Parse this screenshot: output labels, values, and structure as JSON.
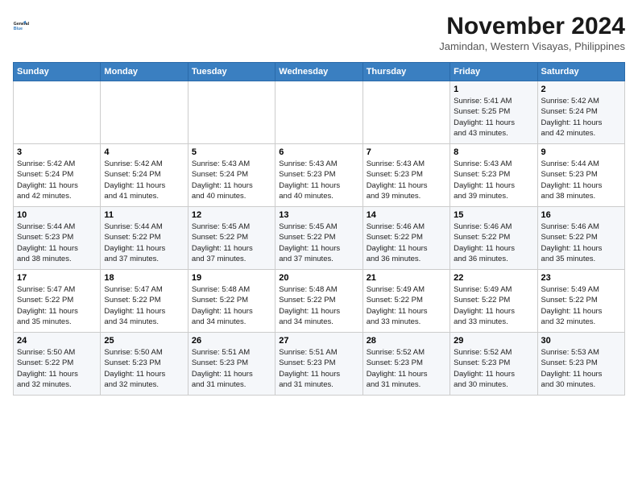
{
  "logo": {
    "line1": "General",
    "line2": "Blue"
  },
  "title": "November 2024",
  "subtitle": "Jamindan, Western Visayas, Philippines",
  "days_of_week": [
    "Sunday",
    "Monday",
    "Tuesday",
    "Wednesday",
    "Thursday",
    "Friday",
    "Saturday"
  ],
  "weeks": [
    [
      {
        "day": "",
        "info": ""
      },
      {
        "day": "",
        "info": ""
      },
      {
        "day": "",
        "info": ""
      },
      {
        "day": "",
        "info": ""
      },
      {
        "day": "",
        "info": ""
      },
      {
        "day": "1",
        "info": "Sunrise: 5:41 AM\nSunset: 5:25 PM\nDaylight: 11 hours\nand 43 minutes."
      },
      {
        "day": "2",
        "info": "Sunrise: 5:42 AM\nSunset: 5:24 PM\nDaylight: 11 hours\nand 42 minutes."
      }
    ],
    [
      {
        "day": "3",
        "info": "Sunrise: 5:42 AM\nSunset: 5:24 PM\nDaylight: 11 hours\nand 42 minutes."
      },
      {
        "day": "4",
        "info": "Sunrise: 5:42 AM\nSunset: 5:24 PM\nDaylight: 11 hours\nand 41 minutes."
      },
      {
        "day": "5",
        "info": "Sunrise: 5:43 AM\nSunset: 5:24 PM\nDaylight: 11 hours\nand 40 minutes."
      },
      {
        "day": "6",
        "info": "Sunrise: 5:43 AM\nSunset: 5:23 PM\nDaylight: 11 hours\nand 40 minutes."
      },
      {
        "day": "7",
        "info": "Sunrise: 5:43 AM\nSunset: 5:23 PM\nDaylight: 11 hours\nand 39 minutes."
      },
      {
        "day": "8",
        "info": "Sunrise: 5:43 AM\nSunset: 5:23 PM\nDaylight: 11 hours\nand 39 minutes."
      },
      {
        "day": "9",
        "info": "Sunrise: 5:44 AM\nSunset: 5:23 PM\nDaylight: 11 hours\nand 38 minutes."
      }
    ],
    [
      {
        "day": "10",
        "info": "Sunrise: 5:44 AM\nSunset: 5:23 PM\nDaylight: 11 hours\nand 38 minutes."
      },
      {
        "day": "11",
        "info": "Sunrise: 5:44 AM\nSunset: 5:22 PM\nDaylight: 11 hours\nand 37 minutes."
      },
      {
        "day": "12",
        "info": "Sunrise: 5:45 AM\nSunset: 5:22 PM\nDaylight: 11 hours\nand 37 minutes."
      },
      {
        "day": "13",
        "info": "Sunrise: 5:45 AM\nSunset: 5:22 PM\nDaylight: 11 hours\nand 37 minutes."
      },
      {
        "day": "14",
        "info": "Sunrise: 5:46 AM\nSunset: 5:22 PM\nDaylight: 11 hours\nand 36 minutes."
      },
      {
        "day": "15",
        "info": "Sunrise: 5:46 AM\nSunset: 5:22 PM\nDaylight: 11 hours\nand 36 minutes."
      },
      {
        "day": "16",
        "info": "Sunrise: 5:46 AM\nSunset: 5:22 PM\nDaylight: 11 hours\nand 35 minutes."
      }
    ],
    [
      {
        "day": "17",
        "info": "Sunrise: 5:47 AM\nSunset: 5:22 PM\nDaylight: 11 hours\nand 35 minutes."
      },
      {
        "day": "18",
        "info": "Sunrise: 5:47 AM\nSunset: 5:22 PM\nDaylight: 11 hours\nand 34 minutes."
      },
      {
        "day": "19",
        "info": "Sunrise: 5:48 AM\nSunset: 5:22 PM\nDaylight: 11 hours\nand 34 minutes."
      },
      {
        "day": "20",
        "info": "Sunrise: 5:48 AM\nSunset: 5:22 PM\nDaylight: 11 hours\nand 34 minutes."
      },
      {
        "day": "21",
        "info": "Sunrise: 5:49 AM\nSunset: 5:22 PM\nDaylight: 11 hours\nand 33 minutes."
      },
      {
        "day": "22",
        "info": "Sunrise: 5:49 AM\nSunset: 5:22 PM\nDaylight: 11 hours\nand 33 minutes."
      },
      {
        "day": "23",
        "info": "Sunrise: 5:49 AM\nSunset: 5:22 PM\nDaylight: 11 hours\nand 32 minutes."
      }
    ],
    [
      {
        "day": "24",
        "info": "Sunrise: 5:50 AM\nSunset: 5:22 PM\nDaylight: 11 hours\nand 32 minutes."
      },
      {
        "day": "25",
        "info": "Sunrise: 5:50 AM\nSunset: 5:23 PM\nDaylight: 11 hours\nand 32 minutes."
      },
      {
        "day": "26",
        "info": "Sunrise: 5:51 AM\nSunset: 5:23 PM\nDaylight: 11 hours\nand 31 minutes."
      },
      {
        "day": "27",
        "info": "Sunrise: 5:51 AM\nSunset: 5:23 PM\nDaylight: 11 hours\nand 31 minutes."
      },
      {
        "day": "28",
        "info": "Sunrise: 5:52 AM\nSunset: 5:23 PM\nDaylight: 11 hours\nand 31 minutes."
      },
      {
        "day": "29",
        "info": "Sunrise: 5:52 AM\nSunset: 5:23 PM\nDaylight: 11 hours\nand 30 minutes."
      },
      {
        "day": "30",
        "info": "Sunrise: 5:53 AM\nSunset: 5:23 PM\nDaylight: 11 hours\nand 30 minutes."
      }
    ]
  ]
}
